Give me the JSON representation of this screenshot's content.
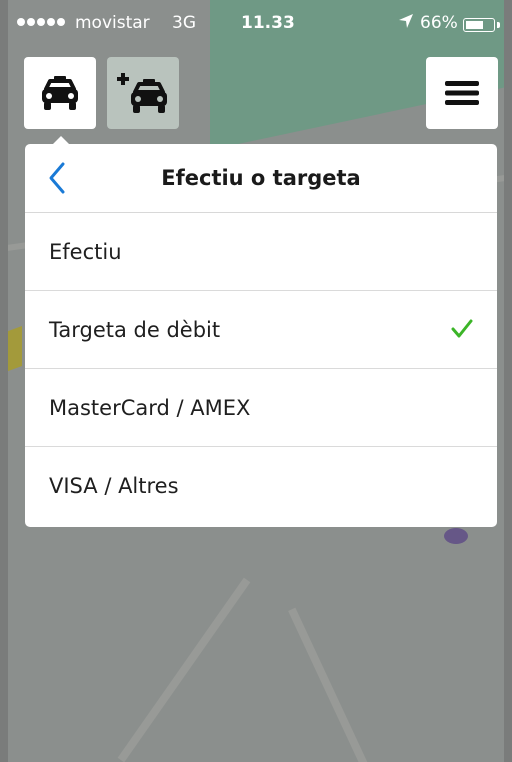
{
  "status_bar": {
    "carrier": "movistar",
    "network": "3G",
    "time": "11.33",
    "battery": "66%",
    "battery_level": 0.66,
    "location_icon": "location-arrow-icon"
  },
  "toolbar": {
    "taxi_icon": "taxi-icon",
    "add_taxi_icon": "add-taxi-icon",
    "menu_icon": "hamburger-menu-icon"
  },
  "payment_panel": {
    "title": "Efectiu o targeta",
    "options": [
      {
        "label": "Efectiu",
        "selected": false
      },
      {
        "label": "Targeta de dèbit",
        "selected": true
      },
      {
        "label": "MasterCard / AMEX",
        "selected": false
      },
      {
        "label": "VISA / Altres",
        "selected": false
      }
    ]
  },
  "colors": {
    "accent_blue": "#1a7ad6",
    "check_green": "#3cb528"
  }
}
